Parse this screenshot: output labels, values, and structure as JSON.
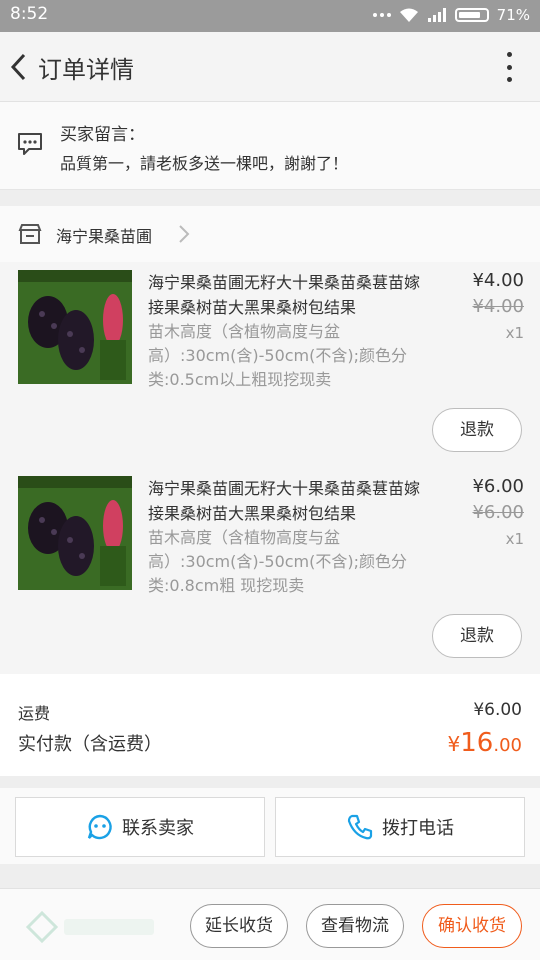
{
  "status_bar": {
    "time": "8:52",
    "battery": "71%"
  },
  "header": {
    "title": "订单详情"
  },
  "buyer_note": {
    "label": "买家留言：",
    "text": "品質第一，請老板多送一棵吧，謝謝了！"
  },
  "shop": {
    "name": "海宁果桑苗圃"
  },
  "items": [
    {
      "title": "海宁果桑苗圃无籽大十果桑苗桑葚苗嫁接果桑树苗大黑果桑树包结果",
      "spec": "苗木高度（含植物高度与盆高）:30cm(含)-50cm(不含);颜色分类:0.5cm以上粗现挖现卖",
      "price": "¥4.00",
      "original_price": "¥4.00",
      "quantity": "x1",
      "refund_label": "退款"
    },
    {
      "title": "海宁果桑苗圃无籽大十果桑苗桑葚苗嫁接果桑树苗大黑果桑树包结果",
      "spec": "苗木高度（含植物高度与盆高）:30cm(含)-50cm(不含);颜色分类:0.8cm粗 现挖现卖",
      "price": "¥6.00",
      "original_price": "¥6.00",
      "quantity": "x1",
      "refund_label": "退款"
    }
  ],
  "totals": {
    "shipping_label": "运费",
    "shipping_value": "¥6.00",
    "paid_label": "实付款（含运费）",
    "paid_currency": "¥",
    "paid_integer": "16",
    "paid_decimal": ".00"
  },
  "contact": {
    "seller_label": "联系卖家",
    "call_label": "拨打电话"
  },
  "actions": {
    "extend_label": "延长收货",
    "logistics_label": "查看物流",
    "confirm_label": "确认收货"
  },
  "colors": {
    "accent": "#f05c1c",
    "link_blue": "#1aa1e6"
  }
}
